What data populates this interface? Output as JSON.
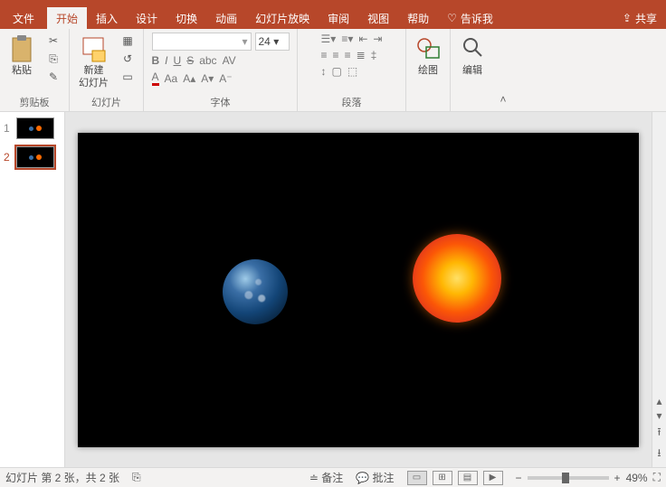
{
  "tabs": {
    "file": "文件",
    "home": "开始",
    "insert": "插入",
    "design": "设计",
    "transitions": "切换",
    "animations": "动画",
    "slideshow": "幻灯片放映",
    "review": "审阅",
    "view": "视图",
    "help": "帮助",
    "tellme": "告诉我",
    "share": "共享"
  },
  "ribbon": {
    "paste": "粘贴",
    "clipboard": "剪贴板",
    "newSlide": "新建",
    "newSlide2": "幻灯片",
    "slides": "幻灯片",
    "fontSize": "24",
    "font": "字体",
    "paragraph": "段落",
    "drawing": "绘图",
    "editing": "编辑"
  },
  "thumbs": {
    "n1": "1",
    "n2": "2"
  },
  "status": {
    "slideInfo": "幻灯片 第 2 张，共 2 张",
    "notes": "备注",
    "comments": "批注",
    "zoom": "49%",
    "minus": "−",
    "plus": "+"
  }
}
